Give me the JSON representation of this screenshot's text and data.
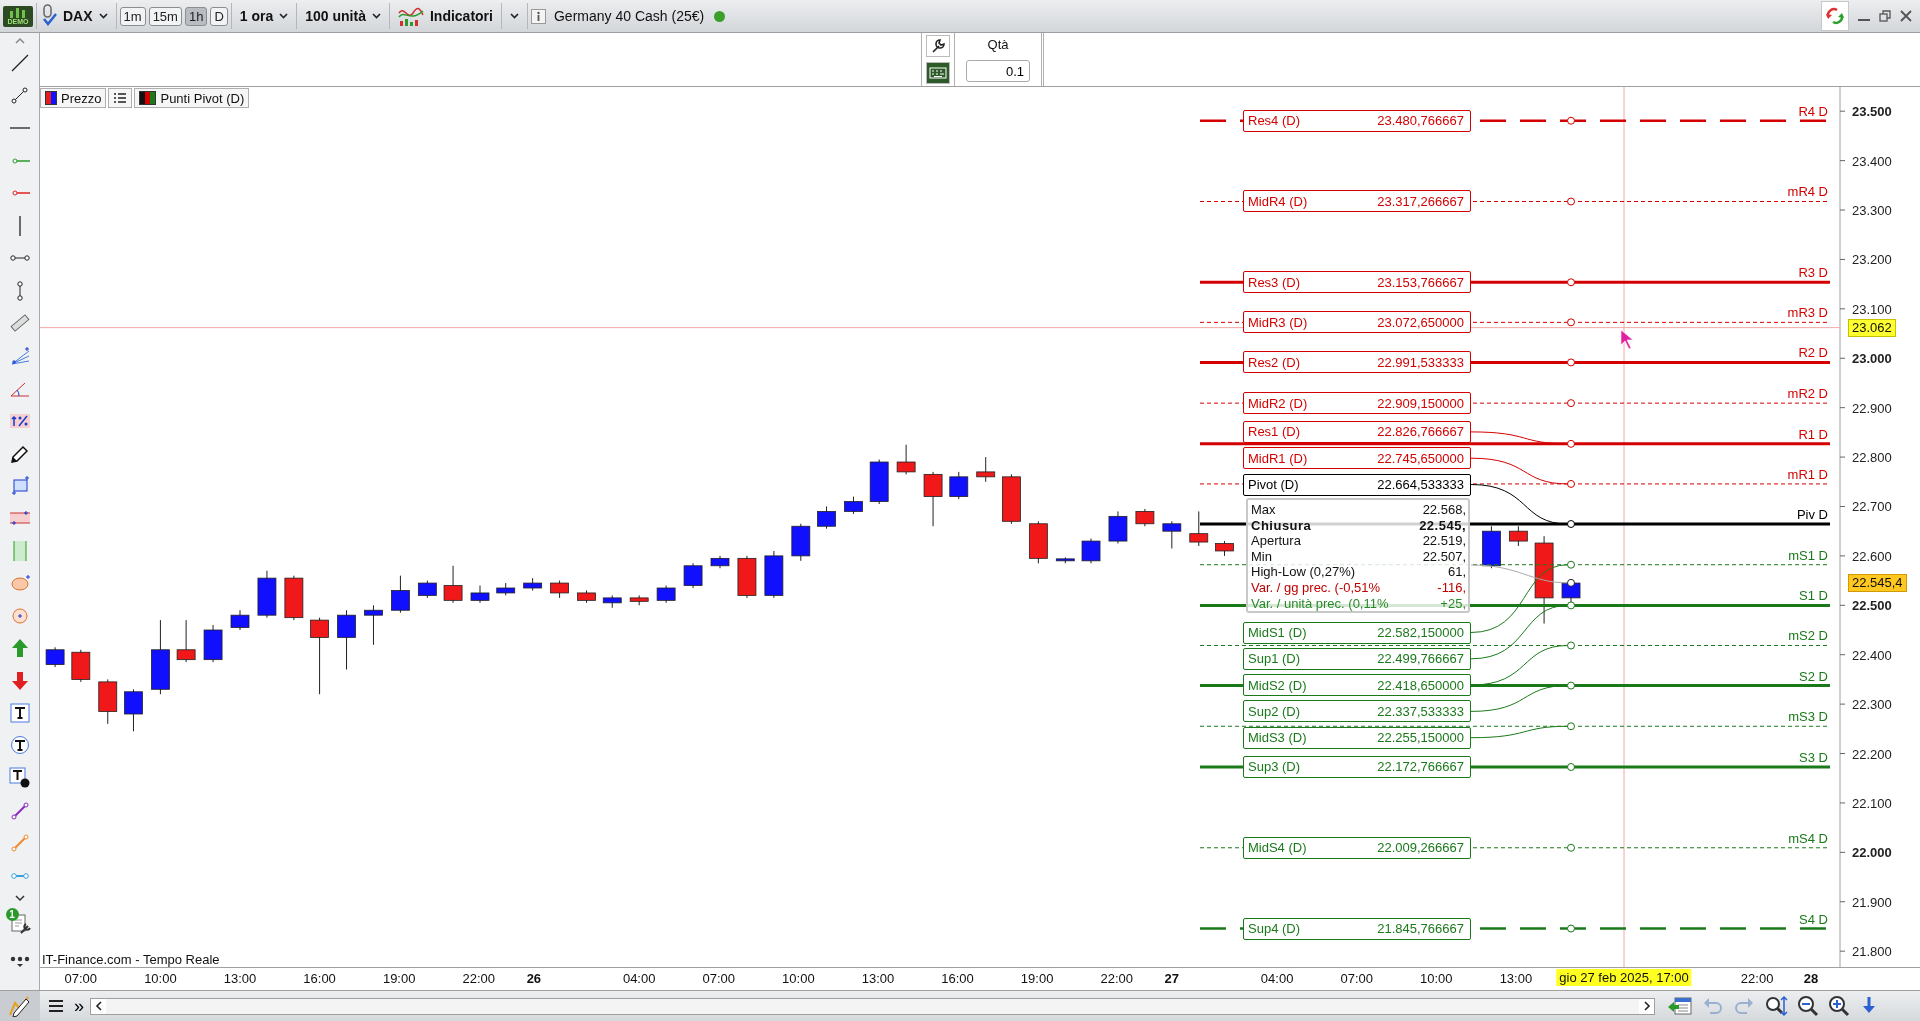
{
  "toolbar": {
    "logo_text": "DEMO",
    "symbol": "DAX",
    "timeframes": [
      {
        "label": "1m",
        "selected": false
      },
      {
        "label": "15m",
        "selected": false
      },
      {
        "label": "1h",
        "selected": true
      },
      {
        "label": "D",
        "selected": false
      }
    ],
    "period": "1 ora",
    "units": "100 unità",
    "indicators": "Indicatori",
    "instrument": "Germany 40 Cash (25€)"
  },
  "order_panel": {
    "quantity_label": "Qtà",
    "quantity": "0.1"
  },
  "legend": [
    {
      "label": "Prezzo"
    },
    {
      "label": "Punti Pivot (D)"
    }
  ],
  "tools_badge": "1",
  "pivot_levels": [
    {
      "name": "Res4 (D)",
      "value": "23.480,766667",
      "tag": "R4 D",
      "kind": "longdash",
      "color": "#d40000"
    },
    {
      "name": "MidR4 (D)",
      "value": "23.317,266667",
      "tag": "mR4 D",
      "kind": "dashed",
      "color": "#d40000"
    },
    {
      "name": "Res3 (D)",
      "value": "23.153,766667",
      "tag": "R3 D",
      "kind": "solid",
      "color": "#d40000"
    },
    {
      "name": "MidR3 (D)",
      "value": "23.072,650000",
      "tag": "mR3 D",
      "kind": "dashed",
      "color": "#d40000"
    },
    {
      "name": "Res2 (D)",
      "value": "22.991,533333",
      "tag": "R2 D",
      "kind": "solid",
      "color": "#d40000"
    },
    {
      "name": "MidR2 (D)",
      "value": "22.909,150000",
      "tag": "mR2 D",
      "kind": "dashed",
      "color": "#d40000"
    },
    {
      "name": "Res1 (D)",
      "value": "22.826,766667",
      "tag": "R1 D",
      "kind": "solid",
      "color": "#d40000"
    },
    {
      "name": "MidR1 (D)",
      "value": "22.745,650000",
      "tag": "mR1 D",
      "kind": "dashed",
      "color": "#d40000"
    },
    {
      "name": "Pivot (D)",
      "value": "22.664,533333",
      "tag": "Piv D",
      "kind": "solid",
      "color": "#000000"
    },
    {
      "name": "MidS1 (D)",
      "value": "22.582,150000",
      "tag": "mS1 D",
      "kind": "dashed",
      "color": "#1a7a1a"
    },
    {
      "name": "Sup1 (D)",
      "value": "22.499,766667",
      "tag": "S1 D",
      "kind": "solid",
      "color": "#1a7a1a"
    },
    {
      "name": "MidS2 (D)",
      "value": "22.418,650000",
      "tag": "mS2 D",
      "kind": "dashed",
      "color": "#1a7a1a"
    },
    {
      "name": "Sup2 (D)",
      "value": "22.337,533333",
      "tag": "S2 D",
      "kind": "solid",
      "color": "#1a7a1a"
    },
    {
      "name": "MidS3 (D)",
      "value": "22.255,150000",
      "tag": "mS3 D",
      "kind": "dashed",
      "color": "#1a7a1a"
    },
    {
      "name": "Sup3 (D)",
      "value": "22.172,766667",
      "tag": "S3 D",
      "kind": "solid",
      "color": "#1a7a1a"
    },
    {
      "name": "MidS4 (D)",
      "value": "22.009,266667",
      "tag": "mS4 D",
      "kind": "dashed",
      "color": "#1a7a1a"
    },
    {
      "name": "Sup4 (D)",
      "value": "21.845,766667",
      "tag": "S4 D",
      "kind": "longdash",
      "color": "#1a7a1a"
    }
  ],
  "tooltip": {
    "rows": [
      {
        "label": "Max",
        "value": "22.568,",
        "kind": "normal"
      },
      {
        "label": "Chiusura",
        "value": "22.545,",
        "kind": "bold"
      },
      {
        "label": "Apertura",
        "value": "22.519,",
        "kind": "normal"
      },
      {
        "label": "Min",
        "value": "22.507,",
        "kind": "normal"
      },
      {
        "label": "High-Low (0,27%)",
        "value": "61,",
        "kind": "normal"
      },
      {
        "label": "Var. / gg prec. (-0,51%",
        "value": "-116,",
        "kind": "down"
      },
      {
        "label": "Var. / unità prec. (0,11%",
        "value": "+25,",
        "kind": "up"
      }
    ]
  },
  "price_axis": {
    "ticks": [
      {
        "label": "23.500",
        "major": true
      },
      {
        "label": "23.400",
        "major": false
      },
      {
        "label": "23.300",
        "major": false
      },
      {
        "label": "23.200",
        "major": false
      },
      {
        "label": "23.100",
        "major": false
      },
      {
        "label": "23.000",
        "major": true
      },
      {
        "label": "22.900",
        "major": false
      },
      {
        "label": "22.800",
        "major": false
      },
      {
        "label": "22.700",
        "major": false
      },
      {
        "label": "22.600",
        "major": false
      },
      {
        "label": "22.500",
        "major": true
      },
      {
        "label": "22.400",
        "major": false
      },
      {
        "label": "22.300",
        "major": false
      },
      {
        "label": "22.200",
        "major": false
      },
      {
        "label": "22.100",
        "major": false
      },
      {
        "label": "22.000",
        "major": true
      },
      {
        "label": "21.900",
        "major": false
      },
      {
        "label": "21.800",
        "major": false
      }
    ],
    "crosshair_label": "23.062",
    "last_price": "22.545,4"
  },
  "time_axis": {
    "ticks": [
      {
        "label": "07:00",
        "major": false
      },
      {
        "label": "10:00",
        "major": false
      },
      {
        "label": "13:00",
        "major": false
      },
      {
        "label": "16:00",
        "major": false
      },
      {
        "label": "19:00",
        "major": false
      },
      {
        "label": "22:00",
        "major": false
      },
      {
        "label": "26",
        "major": true
      },
      {
        "label": "04:00",
        "major": false
      },
      {
        "label": "07:00",
        "major": false
      },
      {
        "label": "10:00",
        "major": false
      },
      {
        "label": "13:00",
        "major": false
      },
      {
        "label": "16:00",
        "major": false
      },
      {
        "label": "19:00",
        "major": false
      },
      {
        "label": "22:00",
        "major": false
      },
      {
        "label": "27",
        "major": true
      },
      {
        "label": "04:00",
        "major": false
      },
      {
        "label": "07:00",
        "major": false
      },
      {
        "label": "10:00",
        "major": false
      },
      {
        "label": "13:00",
        "major": false
      },
      {
        "label": "22:00",
        "major": false
      },
      {
        "label": "28",
        "major": true
      }
    ],
    "crosshair_label": "gio 27 feb 2025, 17:00"
  },
  "source": "IT-Finance.com - Tempo Reale",
  "bottom_bar": {
    "expand": "»"
  }
}
